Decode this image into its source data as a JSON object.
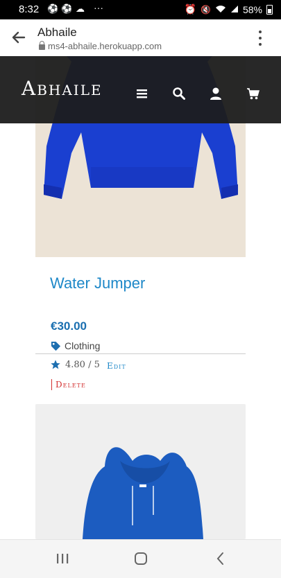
{
  "status_bar": {
    "time": "8:32",
    "battery": "58%",
    "overflow": "···"
  },
  "browser": {
    "title": "Abhaile",
    "url": "ms4-abhaile.herokuapp.com"
  },
  "header": {
    "logo": "Abhaile",
    "icons": [
      "menu-icon",
      "search-icon",
      "account-icon",
      "cart-icon"
    ]
  },
  "product": {
    "name": "Water Jumper",
    "price": "€30.00",
    "category": "Clothing",
    "rating": "4.80 / 5",
    "edit_label": "Edit",
    "delete_label": "Delete"
  },
  "colors": {
    "accent": "#1e88c8",
    "danger": "#d32f2f",
    "header_bg": "#1c1c1c",
    "jumper": "#1a3fd0"
  }
}
